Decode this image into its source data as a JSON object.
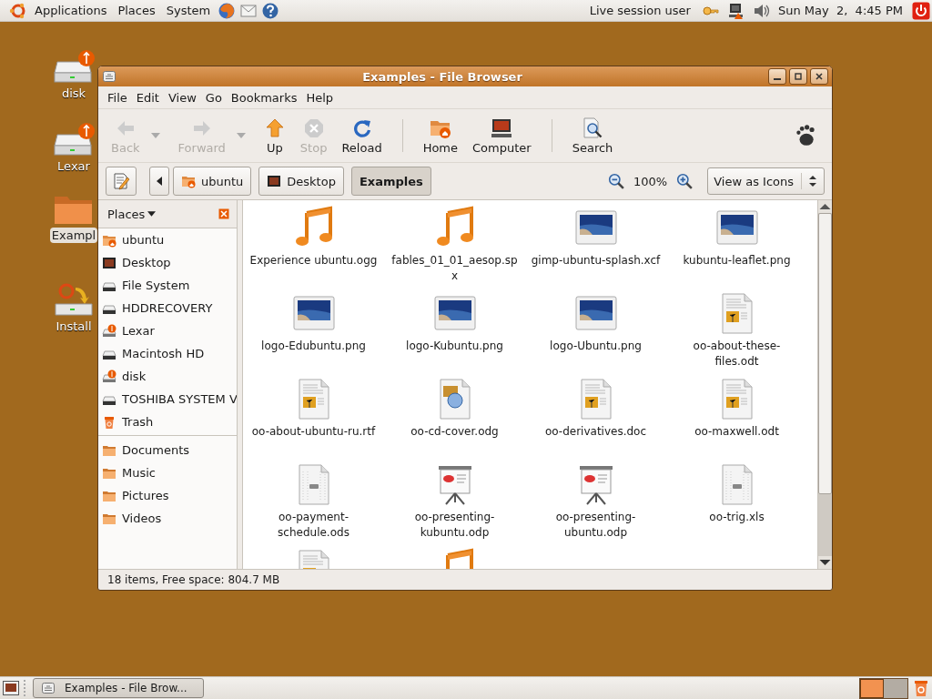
{
  "top_panel": {
    "menus": [
      "Applications",
      "Places",
      "System"
    ],
    "launchers": [
      {
        "kind": "browser"
      },
      {
        "kind": "mail"
      },
      {
        "kind": "help"
      }
    ],
    "user": "Live session user",
    "clock": "Sun May  2,  4:45 PM"
  },
  "desktop_icons": [
    {
      "kind": "usb",
      "label": "disk",
      "selected": false
    },
    {
      "kind": "usb",
      "label": "Lexar",
      "selected": false
    },
    {
      "kind": "folder",
      "label": "Exampl",
      "selected": true
    },
    {
      "kind": "install",
      "label": "Install",
      "selected": false
    }
  ],
  "window": {
    "title": "Examples - File Browser",
    "menu": [
      "File",
      "Edit",
      "View",
      "Go",
      "Bookmarks",
      "Help"
    ],
    "toolbar": [
      [
        {
          "kind": "back",
          "label": "Back",
          "disabled": true,
          "dropdown": true
        },
        {
          "kind": "forward",
          "label": "Forward",
          "disabled": true,
          "dropdown": true
        },
        {
          "kind": "up",
          "label": "Up",
          "disabled": false,
          "dropdown": false
        },
        {
          "kind": "stop",
          "label": "Stop",
          "disabled": true,
          "dropdown": false
        },
        {
          "kind": "reload",
          "label": "Reload",
          "disabled": false,
          "dropdown": false
        }
      ],
      [
        {
          "kind": "home",
          "label": "Home",
          "disabled": false,
          "dropdown": false
        },
        {
          "kind": "computer",
          "label": "Computer",
          "disabled": false,
          "dropdown": false
        }
      ],
      [
        {
          "kind": "search",
          "label": "Search",
          "disabled": false,
          "dropdown": false
        }
      ]
    ],
    "path": [
      {
        "kind": "home",
        "label": "ubuntu",
        "selected": false
      },
      {
        "kind": "desktop",
        "label": "Desktop",
        "selected": false
      },
      {
        "kind": "folder",
        "label": "Examples",
        "selected": true
      }
    ],
    "zoom": "100%",
    "view_mode": "View as Icons",
    "sidebar": {
      "title": "Places",
      "devices": [
        {
          "kind": "home",
          "label": "ubuntu"
        },
        {
          "kind": "desktop",
          "label": "Desktop"
        },
        {
          "kind": "drive",
          "label": "File System"
        },
        {
          "kind": "drive",
          "label": "HDDRECOVERY"
        },
        {
          "kind": "usb",
          "label": "Lexar"
        },
        {
          "kind": "drive",
          "label": "Macintosh HD"
        },
        {
          "kind": "usb",
          "label": "disk"
        },
        {
          "kind": "drive",
          "label": "TOSHIBA SYSTEM V"
        },
        {
          "kind": "trash",
          "label": "Trash"
        }
      ],
      "bookmarks": [
        {
          "kind": "folder",
          "label": "Documents"
        },
        {
          "kind": "folder",
          "label": "Music"
        },
        {
          "kind": "folder",
          "label": "Pictures"
        },
        {
          "kind": "folder",
          "label": "Videos"
        }
      ]
    },
    "files": [
      {
        "kind": "audio",
        "name": "Experience ubuntu.ogg"
      },
      {
        "kind": "audio",
        "name": "fables_01_01_aesop.spx"
      },
      {
        "kind": "image",
        "name": "gimp-ubuntu-splash.xcf"
      },
      {
        "kind": "image",
        "name": "kubuntu-leaflet.png"
      },
      {
        "kind": "image",
        "name": "logo-Edubuntu.png"
      },
      {
        "kind": "image",
        "name": "logo-Kubuntu.png"
      },
      {
        "kind": "image",
        "name": "logo-Ubuntu.png"
      },
      {
        "kind": "document",
        "name": "oo-about-these-files.odt"
      },
      {
        "kind": "document",
        "name": "oo-about-ubuntu-ru.rtf"
      },
      {
        "kind": "drawing",
        "name": "oo-cd-cover.odg"
      },
      {
        "kind": "document",
        "name": "oo-derivatives.doc"
      },
      {
        "kind": "document",
        "name": "oo-maxwell.odt"
      },
      {
        "kind": "spreadsheet",
        "name": "oo-payment-schedule.ods"
      },
      {
        "kind": "presentation",
        "name": "oo-presenting-kubuntu.odp"
      },
      {
        "kind": "presentation",
        "name": "oo-presenting-ubuntu.odp"
      },
      {
        "kind": "spreadsheet",
        "name": "oo-trig.xls"
      },
      {
        "kind": "document"
      },
      {
        "kind": "audio"
      }
    ],
    "status": "18 items, Free space: 804.7 MB"
  },
  "bottom_panel": {
    "tasks": [
      {
        "label": "Examples - File Brow...",
        "selected": false
      }
    ],
    "workspaces": [
      {
        "selected": true
      },
      {
        "selected": false
      }
    ]
  }
}
